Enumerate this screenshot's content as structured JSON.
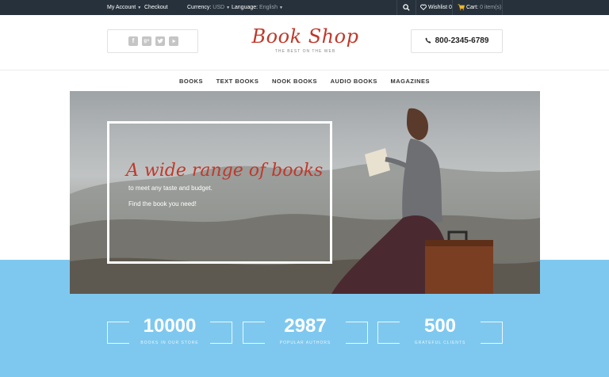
{
  "topbar": {
    "my_account": "My Account",
    "checkout": "Checkout",
    "currency_label": "Currency:",
    "currency_value": "USD",
    "language_label": "Language:",
    "language_value": "English",
    "wishlist_label": "Wishlist",
    "wishlist_count": "0",
    "cart_label": "Cart:",
    "cart_value": "0 item(s)"
  },
  "header": {
    "logo_name": "Book Shop",
    "logo_tagline": "THE BEST ON THE WEB",
    "phone": "800-2345-6789",
    "social_icons": [
      "facebook-icon",
      "google-plus-icon",
      "twitter-icon",
      "youtube-icon"
    ]
  },
  "nav": {
    "items": [
      "BOOKS",
      "TEXT BOOKS",
      "NOOK BOOKS",
      "AUDIO BOOKS",
      "MAGAZINES"
    ]
  },
  "hero": {
    "title": "A wide range of books",
    "line1": "to meet any taste and budget.",
    "line2": "Find the book you need!"
  },
  "stats": [
    {
      "number": "10000",
      "label": "BOOKS IN OUR STORE"
    },
    {
      "number": "2987",
      "label": "POPULAR AUTHORS"
    },
    {
      "number": "500",
      "label": "GRATEFUL CLIENTS"
    }
  ],
  "colors": {
    "topbar_bg": "#26313b",
    "accent_red": "#c0392b",
    "band_blue": "#7ec8ef"
  }
}
